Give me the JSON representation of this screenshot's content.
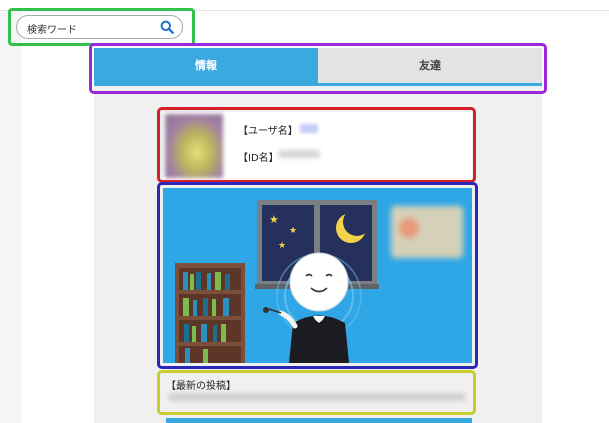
{
  "search": {
    "placeholder": "検索ワード",
    "icon": "search-icon"
  },
  "tabs": [
    {
      "label": "情報",
      "selected": true
    },
    {
      "label": "友達",
      "selected": false
    }
  ],
  "profile": {
    "username_label": "【ユーザ名】",
    "id_label": "【ID名】"
  },
  "latest_post": {
    "label": "【最新の投稿】"
  },
  "colors": {
    "accent": "#3aa9e0",
    "highlight_search": "#33c14c",
    "highlight_tabs": "#9b27d8",
    "highlight_profile": "#d71f2b",
    "highlight_image": "#2b27b8",
    "highlight_post": "#c8cc2c"
  }
}
